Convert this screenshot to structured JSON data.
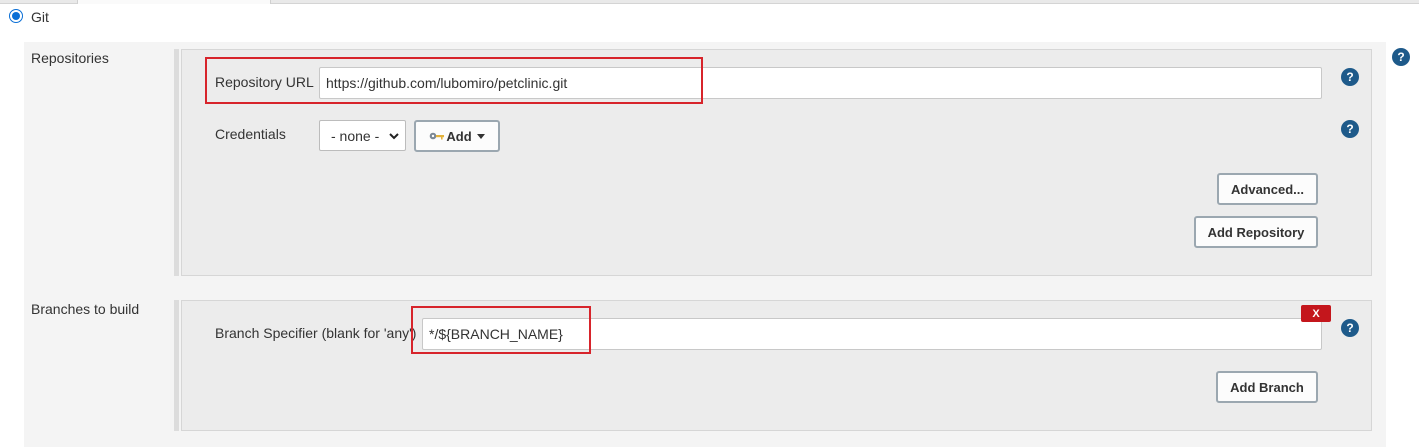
{
  "scm": {
    "option_label": "Git",
    "selected": true
  },
  "repositories": {
    "section_label": "Repositories",
    "repository_url": {
      "label": "Repository URL",
      "value": "https://github.com/lubomiro/petclinic.git"
    },
    "credentials": {
      "label": "Credentials",
      "selected_value": "- none -",
      "add_button_label": "Add"
    },
    "advanced_button_label": "Advanced...",
    "add_repository_button_label": "Add Repository"
  },
  "branches": {
    "section_label": "Branches to build",
    "branch_specifier": {
      "label": "Branch Specifier (blank for 'any')",
      "value": "*/${BRANCH_NAME}"
    },
    "delete_button_label": "X",
    "add_branch_button_label": "Add Branch"
  },
  "help_icon_glyph": "?",
  "colors": {
    "highlight": "#d7242b",
    "help_icon": "#1e5a8a",
    "delete_button": "#c4161c",
    "radio_accent": "#0a6fd6"
  }
}
